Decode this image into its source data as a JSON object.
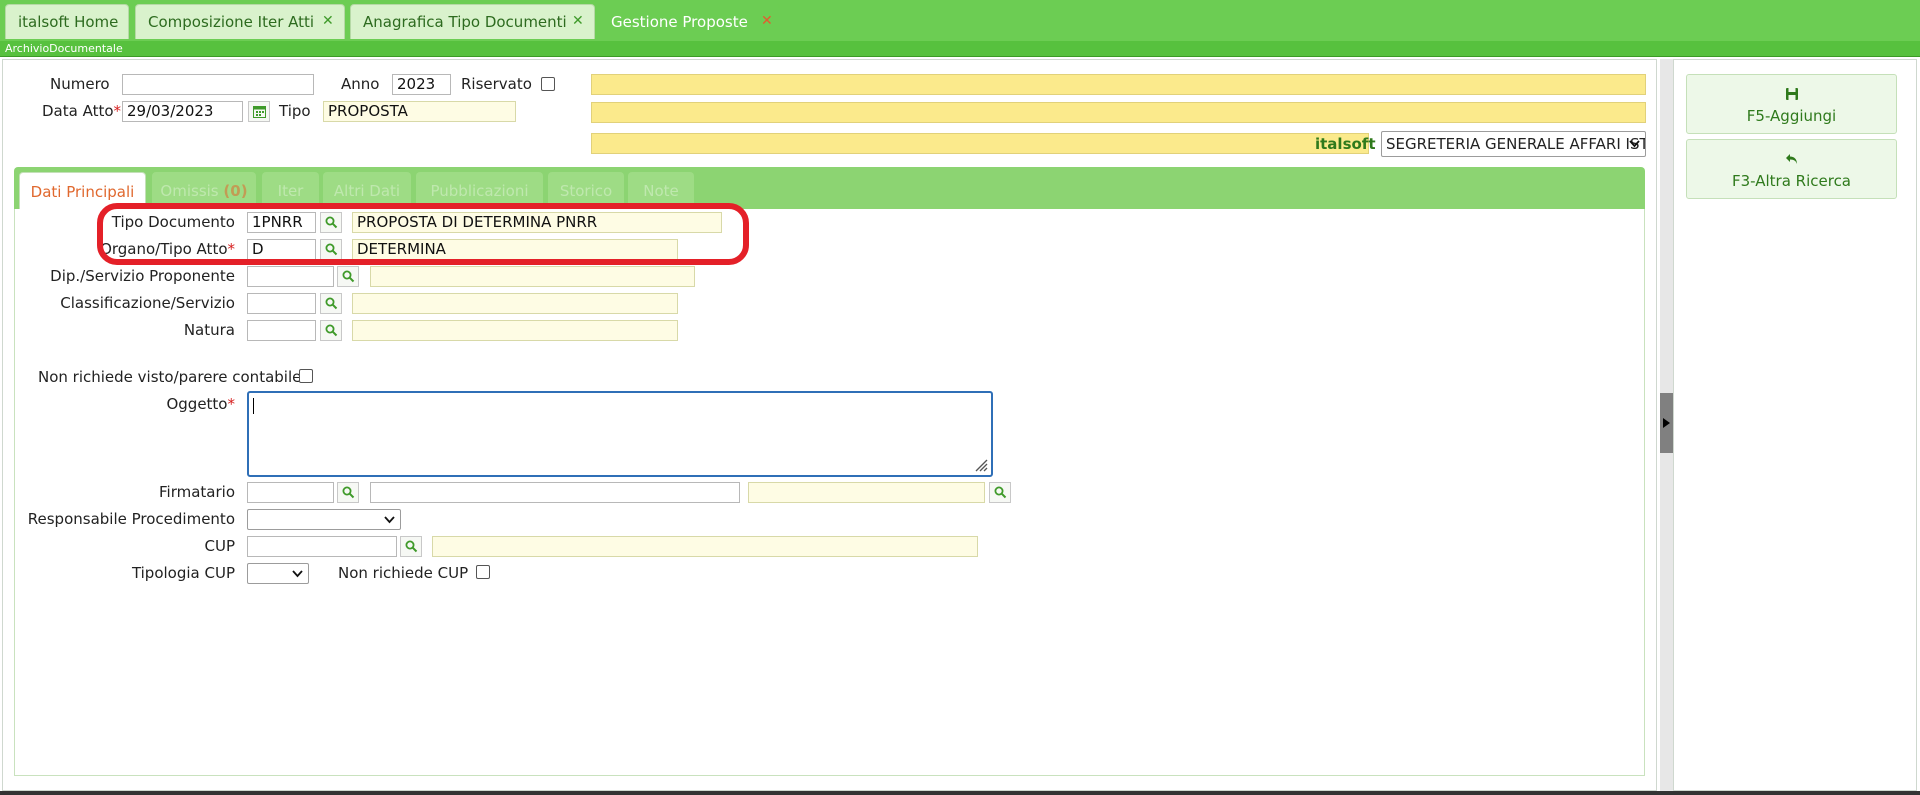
{
  "window_tabs": [
    {
      "label": "italsoft Home",
      "closable": false,
      "active": false
    },
    {
      "label": "Composizione Iter Atti",
      "closable": true,
      "active": false
    },
    {
      "label": "Anagrafica Tipo Documenti",
      "closable": true,
      "active": false
    },
    {
      "label": "Gestione Proposte",
      "closable": true,
      "active": true
    }
  ],
  "breadcrumb": "ArchivioDocumentale",
  "header": {
    "numero_label": "Numero",
    "numero_value": "",
    "anno_label": "Anno",
    "anno_value": "2023",
    "riservato_label": "Riservato",
    "data_atto_label": "Data Atto",
    "data_atto_value": "29/03/2023",
    "tipo_label": "Tipo",
    "tipo_value": "PROPOSTA",
    "brand": "italsoft",
    "ufficio_selected": "SEGRETERIA GENERALE AFFARI IST"
  },
  "tabs": [
    {
      "label": "Dati Principali"
    },
    {
      "label": "Omissis",
      "count": "(0)"
    },
    {
      "label": "Iter"
    },
    {
      "label": "Altri Dati"
    },
    {
      "label": "Pubblicazioni"
    },
    {
      "label": "Storico"
    },
    {
      "label": "Note"
    }
  ],
  "form": {
    "tipo_documento_label": "Tipo Documento",
    "tipo_documento_code": "1PNRR",
    "tipo_documento_desc": "PROPOSTA DI DETERMINA PNRR",
    "organo_label": "Organo/Tipo Atto",
    "organo_code": "D",
    "organo_desc": "DETERMINA",
    "dip_label": "Dip./Servizio Proponente",
    "classificazione_label": "Classificazione/Servizio",
    "natura_label": "Natura",
    "non_visto_label": "Non richiede visto/parere contabile",
    "oggetto_label": "Oggetto",
    "firmatario_label": "Firmatario",
    "responsabile_label": "Responsabile Procedimento",
    "cup_label": "CUP",
    "tipologia_cup_label": "Tipologia CUP",
    "non_cup_label": "Non richiede CUP"
  },
  "actions": [
    {
      "label": "F5-Aggiungi",
      "icon": "save-icon"
    },
    {
      "label": "F3-Altra Ricerca",
      "icon": "undo-arrow-icon"
    }
  ],
  "colors": {
    "tab_green": "#6ccd53",
    "highlight_red": "#e42028",
    "active_tab_text": "#e0682e"
  }
}
